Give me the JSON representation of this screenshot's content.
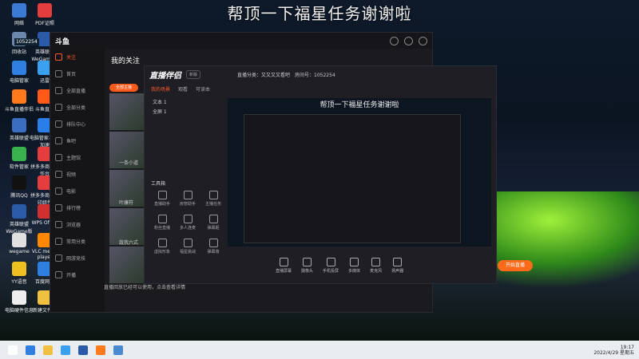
{
  "banner": {
    "text": "帮顶一下福星任务谢谢啦"
  },
  "desktop": {
    "counter": "1052254",
    "icons": [
      {
        "label": "网络",
        "color": "#3b7bd6"
      },
      {
        "label": "PDF证照",
        "color": "#e43d3d"
      },
      {
        "label": "回收站",
        "color": "#6a89aa"
      },
      {
        "label": "英雄联盟WeGame版",
        "color": "#2b5aa8"
      },
      {
        "label": "电脑管家",
        "color": "#2f7fe0"
      },
      {
        "label": "迅雷",
        "color": "#3aa0f0"
      },
      {
        "label": "斗鱼直播伴侣",
        "color": "#ff7a1a"
      },
      {
        "label": "斗鱼直播",
        "color": "#ff5a1a"
      },
      {
        "label": "英雄联盟",
        "color": "#3a6ec0"
      },
      {
        "label": "电脑管家-游戏加速",
        "color": "#2a7ee8"
      },
      {
        "label": "软件管家",
        "color": "#37b24d"
      },
      {
        "label": "拼多多商家工作台",
        "color": "#e43d3d"
      },
      {
        "label": "腾讯QQ",
        "color": "#111"
      },
      {
        "label": "拼多多商家打印组件",
        "color": "#e43d3d"
      },
      {
        "label": "英雄联盟WeGame版",
        "color": "#2b5aa8"
      },
      {
        "label": "WPS Office",
        "color": "#d03030"
      },
      {
        "label": "wegame",
        "color": "#e0e0e0"
      },
      {
        "label": "VLC media player",
        "color": "#ff8800"
      },
      {
        "label": "YY语音",
        "color": "#f0c020"
      },
      {
        "label": "百度网盘",
        "color": "#2f7fe0"
      },
      {
        "label": "电脑硬件信息",
        "color": "#eee"
      },
      {
        "label": "新建文件夹",
        "color": "#f0c040"
      }
    ]
  },
  "app": {
    "logo": "斗鱼",
    "sidebar": [
      "关注",
      "首页",
      "全部直播",
      "全部分类",
      "排队中心",
      "鱼吧",
      "主题馆",
      "视频",
      "电影",
      "排行榜",
      "浏览器",
      "常用分类",
      "网游竞技",
      "开播"
    ],
    "page_title": "我的关注",
    "follow_button": "全部主播",
    "thumbs": [
      {
        "name": "一条小道"
      },
      {
        "name": "叶康符"
      },
      {
        "name": "敌我六式"
      }
    ]
  },
  "overlay": {
    "logo": "直播伴侣",
    "version": "新版",
    "tabs": [
      "我的场景",
      "观看",
      "可读本"
    ],
    "scenes": [
      "文本 1",
      "全屏 1"
    ],
    "tools_title": "工具箱",
    "tools": [
      "直播助手",
      "房管助手",
      "主播任务",
      "粉丝直播",
      "多人连麦",
      "弹幕姬",
      "虚拟形象",
      "福星挑战",
      "弹幕墙"
    ],
    "preview_title": "帮顶一下福星任务谢谢啦",
    "room_label": "直播分类：又又又又看吧",
    "room_id": "房间号：1052254",
    "bottom_items": [
      "直播屏幕",
      "摄像头",
      "手机投屏",
      "多媒体",
      "麦克风",
      "扬声器"
    ],
    "start_button": "开始直播",
    "status": "直播回放已经可以使用，点击查看详情"
  },
  "taskbar": {
    "time": "19:17",
    "date": "2022/4/29 星期五",
    "apps": [
      "#ffffff",
      "#2f7fe0",
      "#f0c040",
      "#3aa0f0",
      "#2b5aa8",
      "#ff7a1a",
      "#4a8ad0"
    ]
  }
}
